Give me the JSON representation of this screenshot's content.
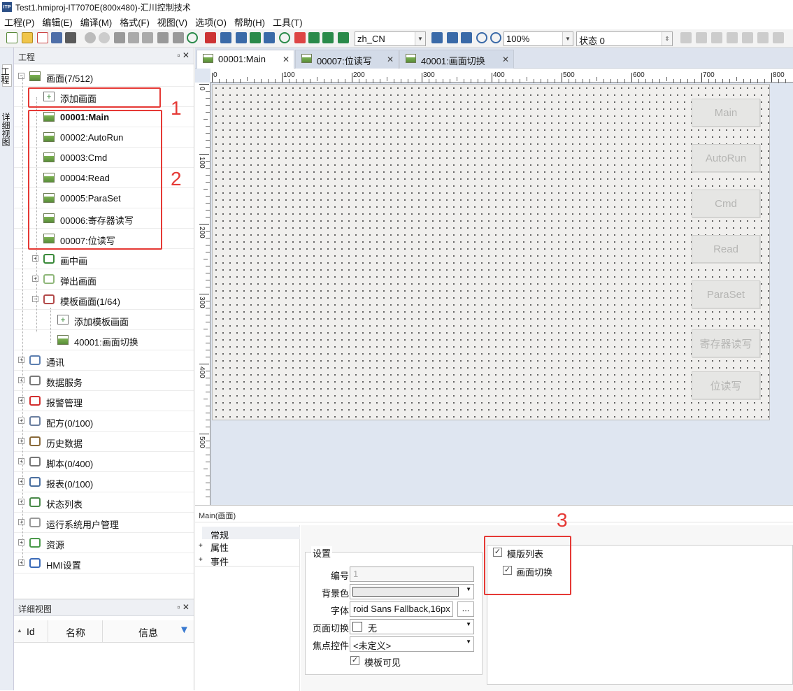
{
  "window": {
    "title": "Test1.hmiproj-IT7070E(800x480)-汇川控制技术",
    "logo": "ITP"
  },
  "menu": [
    "工程(P)",
    "编辑(E)",
    "编译(M)",
    "格式(F)",
    "视图(V)",
    "选项(O)",
    "帮助(H)",
    "工具(T)"
  ],
  "toolbar": {
    "language": "zh_CN",
    "zoom": "100%",
    "state": "状态 0"
  },
  "left_strip": {
    "tab1": "工程",
    "tab2": "详细视图"
  },
  "project_panel": {
    "header": "工程",
    "controls": "▫ ✕",
    "tree": [
      {
        "label": "画面(7/512)",
        "level": 0,
        "expander": "−",
        "icon": "screen-folder-icon"
      },
      {
        "label": "添加画面",
        "level": 1,
        "icon": "add-icon"
      },
      {
        "label": "00001:Main",
        "level": 1,
        "icon": "image-icon",
        "bold": true
      },
      {
        "label": "00002:AutoRun",
        "level": 1,
        "icon": "image-icon"
      },
      {
        "label": "00003:Cmd",
        "level": 1,
        "icon": "image-icon"
      },
      {
        "label": "00004:Read",
        "level": 1,
        "icon": "image-icon"
      },
      {
        "label": "00005:ParaSet",
        "level": 1,
        "icon": "image-icon"
      },
      {
        "label": "00006:寄存器读写",
        "level": 1,
        "icon": "image-icon"
      },
      {
        "label": "00007:位读写",
        "level": 1,
        "icon": "image-icon"
      },
      {
        "label": "画中画",
        "level": 1,
        "expander": "+",
        "icon": "pip-icon"
      },
      {
        "label": "弹出画面",
        "level": 1,
        "expander": "+",
        "icon": "popup-icon"
      },
      {
        "label": "模板画面(1/64)",
        "level": 1,
        "expander": "−",
        "icon": "template-icon"
      },
      {
        "label": "添加模板画面",
        "level": 2,
        "icon": "add-icon"
      },
      {
        "label": "40001:画面切换",
        "level": 2,
        "icon": "image-icon"
      },
      {
        "label": "通讯",
        "level": 0,
        "expander": "+",
        "icon": "globe-icon"
      },
      {
        "label": "数据服务",
        "level": 0,
        "expander": "+",
        "icon": "database-icon"
      },
      {
        "label": "报警管理",
        "level": 0,
        "expander": "+",
        "icon": "alarm-icon"
      },
      {
        "label": "配方(0/100)",
        "level": 0,
        "expander": "+",
        "icon": "flask-icon"
      },
      {
        "label": "历史数据",
        "level": 0,
        "expander": "+",
        "icon": "history-icon"
      },
      {
        "label": "脚本(0/400)",
        "level": 0,
        "expander": "+",
        "icon": "script-icon"
      },
      {
        "label": "报表(0/100)",
        "level": 0,
        "expander": "+",
        "icon": "report-icon"
      },
      {
        "label": "状态列表",
        "level": 0,
        "expander": "+",
        "icon": "list-icon"
      },
      {
        "label": "运行系统用户管理",
        "level": 0,
        "expander": "+",
        "icon": "user-icon"
      },
      {
        "label": "资源",
        "level": 0,
        "expander": "+",
        "icon": "resource-icon"
      },
      {
        "label": "HMI设置",
        "level": 0,
        "expander": "+",
        "icon": "gear-icon"
      }
    ]
  },
  "detail_panel": {
    "header": "详细视图",
    "controls": "▫ ✕",
    "col_id": "Id",
    "col_name": "名称",
    "col_info": "信息"
  },
  "tabs": [
    "00001:Main",
    "00007:位读写",
    "40001:画面切换"
  ],
  "ruler": {
    "h": [
      "0",
      "100",
      "200",
      "300",
      "400",
      "500",
      "600",
      "700",
      "800"
    ],
    "v": [
      "0",
      "100",
      "200",
      "300",
      "400",
      "500"
    ]
  },
  "screen_buttons": [
    "Main",
    "AutoRun",
    "Cmd",
    "Read",
    "ParaSet",
    "寄存器读写",
    "位读写"
  ],
  "props": {
    "header": "Main(画面)",
    "nav": [
      "常规",
      "属性",
      "事件"
    ],
    "group_title": "设置",
    "number_label": "编号",
    "number_value": "1",
    "bg_label": "背景色",
    "font_label": "字体",
    "font_value": "roid Sans Fallback,16px",
    "font_btn": "...",
    "page_switch_label": "页面切换",
    "page_switch_value": "无",
    "focus_label": "焦点控件",
    "focus_value": "<未定义>",
    "template_visible": "模板可见",
    "template_list_title": "模版列表",
    "template_list_item": "画面切换"
  },
  "annotations": [
    "1",
    "2",
    "3"
  ],
  "colors": {
    "annotation": "#e53935",
    "accent": "#2b4f86"
  }
}
